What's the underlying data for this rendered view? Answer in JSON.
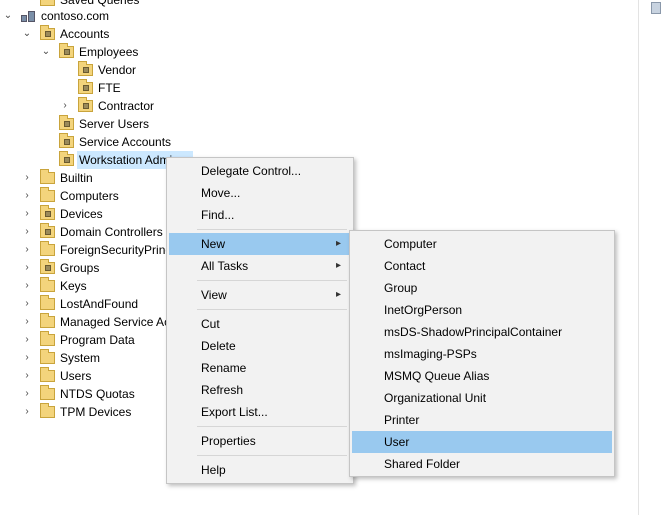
{
  "tree": {
    "saved_queries": "Saved Queries",
    "domain": "contoso.com",
    "accounts": "Accounts",
    "employees": "Employees",
    "vendor": "Vendor",
    "fte": "FTE",
    "contractor": "Contractor",
    "server_users": "Server Users",
    "service_accounts": "Service Accounts",
    "workstation_admins": "Workstation Admi",
    "builtin": "Builtin",
    "computers": "Computers",
    "devices": "Devices",
    "domain_controllers": "Domain Controllers",
    "foreign_security": "ForeignSecurityPrinc",
    "groups": "Groups",
    "keys": "Keys",
    "lost_and_found": "LostAndFound",
    "managed_service": "Managed Service Ac",
    "program_data": "Program Data",
    "system": "System",
    "users": "Users",
    "ntds_quotas": "NTDS Quotas",
    "tpm_devices": "TPM Devices"
  },
  "context_menu": {
    "delegate": "Delegate Control...",
    "move": "Move...",
    "find": "Find...",
    "new": "New",
    "all_tasks": "All Tasks",
    "view": "View",
    "cut": "Cut",
    "delete": "Delete",
    "rename": "Rename",
    "refresh": "Refresh",
    "export": "Export List...",
    "properties": "Properties",
    "help": "Help"
  },
  "submenu": {
    "computer": "Computer",
    "contact": "Contact",
    "group": "Group",
    "inetorgperson": "InetOrgPerson",
    "shadow": "msDS-ShadowPrincipalContainer",
    "imaging": "msImaging-PSPs",
    "msmq": "MSMQ Queue Alias",
    "ou": "Organizational Unit",
    "printer": "Printer",
    "user": "User",
    "shared_folder": "Shared Folder"
  },
  "colors": {
    "highlight": "#99c9ef",
    "selected_node": "#cce8ff",
    "menu_bg": "#f2f2f2"
  },
  "icons": {
    "expand": "chevron-right-icon",
    "collapse": "chevron-down-icon",
    "folder": "folder-icon",
    "ou": "organizational-unit-icon",
    "domain": "domain-icon"
  }
}
